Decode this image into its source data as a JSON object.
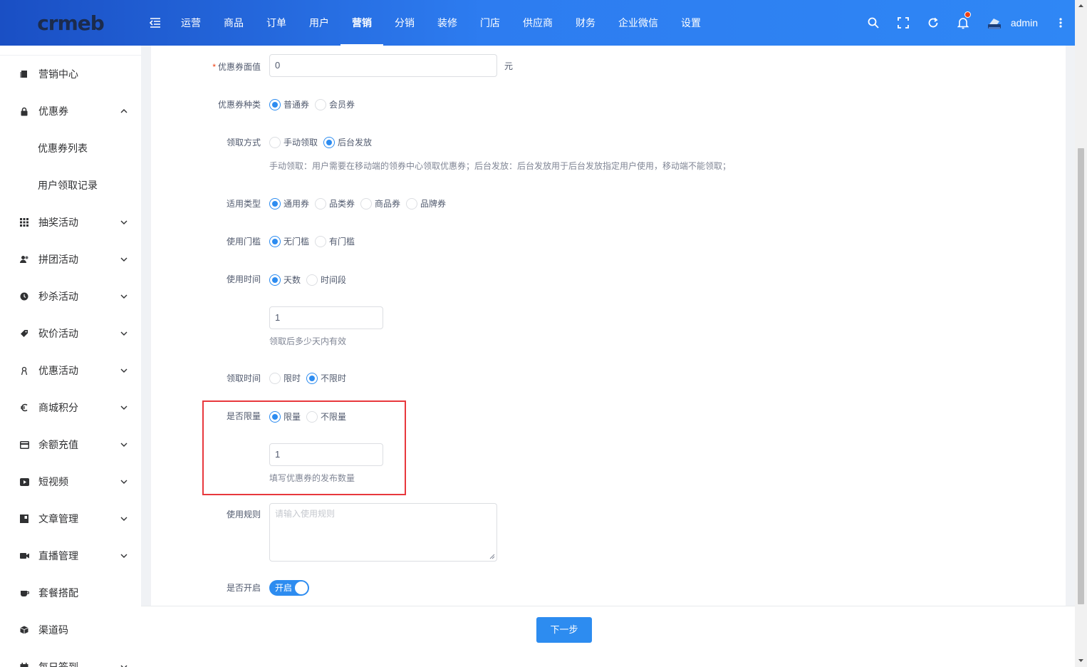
{
  "header": {
    "logo": "crmeb",
    "nav": [
      "运营",
      "商品",
      "订单",
      "用户",
      "营销",
      "分销",
      "装修",
      "门店",
      "供应商",
      "财务",
      "企业微信",
      "设置"
    ],
    "active_nav_index": 4,
    "username": "admin",
    "icons": [
      "search-icon",
      "fullscreen-icon",
      "refresh-icon",
      "bell-icon",
      "avatar",
      "more-icon"
    ]
  },
  "sidebar": {
    "items": [
      {
        "label": "营销中心",
        "icon": "document-icon",
        "expandable": false
      },
      {
        "label": "优惠券",
        "icon": "lock-icon",
        "expandable": true,
        "expanded": true,
        "children": [
          "优惠券列表",
          "用户领取记录"
        ]
      },
      {
        "label": "抽奖活动",
        "icon": "grid-icon",
        "expandable": true
      },
      {
        "label": "拼团活动",
        "icon": "group-icon",
        "expandable": true
      },
      {
        "label": "秒杀活动",
        "icon": "clock-icon",
        "expandable": true
      },
      {
        "label": "砍价活动",
        "icon": "tag-icon",
        "expandable": true
      },
      {
        "label": "优惠活动",
        "icon": "gift-icon",
        "expandable": true
      },
      {
        "label": "商城积分",
        "icon": "euro-icon",
        "expandable": true
      },
      {
        "label": "余额充值",
        "icon": "card-icon",
        "expandable": true
      },
      {
        "label": "短视频",
        "icon": "video-icon",
        "expandable": true
      },
      {
        "label": "文章管理",
        "icon": "article-icon",
        "expandable": true
      },
      {
        "label": "直播管理",
        "icon": "camera-icon",
        "expandable": true
      },
      {
        "label": "套餐搭配",
        "icon": "cup-icon",
        "expandable": false
      },
      {
        "label": "渠道码",
        "icon": "cube-icon",
        "expandable": false
      },
      {
        "label": "每日签到",
        "icon": "calendar-icon",
        "expandable": true
      }
    ]
  },
  "form": {
    "face_value": {
      "label": "优惠券面值",
      "value": "0",
      "unit": "元"
    },
    "coupon_kind": {
      "label": "优惠券种类",
      "options": [
        "普通券",
        "会员券"
      ],
      "selected": 0
    },
    "receive_method": {
      "label": "领取方式",
      "options": [
        "手动领取",
        "后台发放"
      ],
      "selected": 1,
      "tip": "手动领取：用户需要在移动端的领券中心领取优惠券；后台发放：后台发放用于后台发放指定用户使用，移动端不能领取；"
    },
    "apply_type": {
      "label": "适用类型",
      "options": [
        "通用券",
        "品类券",
        "商品券",
        "品牌券"
      ],
      "selected": 0
    },
    "threshold": {
      "label": "使用门槛",
      "options": [
        "无门槛",
        "有门槛"
      ],
      "selected": 0
    },
    "use_time": {
      "label": "使用时间",
      "options": [
        "天数",
        "时间段"
      ],
      "selected": 0,
      "value": "1",
      "tip": "领取后多少天内有效"
    },
    "receive_time": {
      "label": "领取时间",
      "options": [
        "限时",
        "不限时"
      ],
      "selected": 1
    },
    "limit": {
      "label": "是否限量",
      "options": [
        "限量",
        "不限量"
      ],
      "selected": 0,
      "value": "1",
      "tip": "填写优惠券的发布数量"
    },
    "rules": {
      "label": "使用规则",
      "placeholder": "请输入使用规则"
    },
    "enabled": {
      "label": "是否开启",
      "switch_text": "开启",
      "on": true
    }
  },
  "footer": {
    "next_label": "下一步"
  },
  "colors": {
    "primary": "#2d8cf0",
    "highlight": "#e8383d",
    "header_start": "#1a4fc4",
    "header_end": "#2f87f5"
  }
}
